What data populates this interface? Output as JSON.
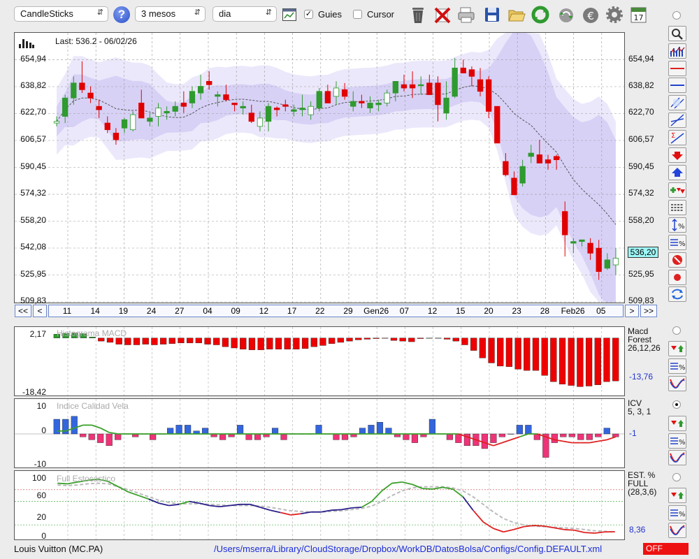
{
  "toolbar": {
    "chart_type": "CandleSticks",
    "period": "3 mesos",
    "interval": "dia",
    "guides_label": "Guies",
    "guides_checked": true,
    "cursor_label": "Cursor",
    "cursor_checked": false,
    "help_label": "?",
    "calendar_day": "17"
  },
  "main_chart": {
    "last_label": "Last: 536.2 - 06/02/26",
    "price_ticks": [
      "654,94",
      "638,82",
      "622,70",
      "606,57",
      "590,45",
      "574,32",
      "558,20",
      "542,08",
      "525,95",
      "509,83"
    ],
    "current_price": "536,20",
    "date_ticks": [
      "11",
      "14",
      "19",
      "24",
      "27",
      "04",
      "09",
      "12",
      "17",
      "22",
      "29",
      "Gen26",
      "07",
      "12",
      "15",
      "20",
      "23",
      "28",
      "Feb26",
      "05"
    ],
    "nav_first": "<<",
    "nav_prev": "<",
    "nav_next": ">",
    "nav_last": ">>"
  },
  "macd_panel": {
    "title": "Histograma MACD",
    "top_value": "2,17",
    "bottom_value": "-18,42",
    "name": "Macd",
    "subname": "Forest",
    "params": "26,12,26",
    "current_value": "-13,76"
  },
  "icv_panel": {
    "title": "Indice Calidad Vela",
    "ticks": [
      "10",
      "0",
      "-10"
    ],
    "name": "ICV",
    "params": "5, 3, 1",
    "current_value": "-1"
  },
  "stoch_panel": {
    "title": "Full Estocastico",
    "ticks": [
      "100",
      "60",
      "20",
      "0"
    ],
    "name": "EST. %",
    "subname": "FULL",
    "params": "(28,3,6)",
    "current_value": "8,36"
  },
  "status_bar": {
    "instrument": "Louis Vuitton (MC.PA)",
    "config_path": "/Users/mserra/Library/CloudStorage/Dropbox/WorkDB/DatosBolsa/Configs/Config.DEFAULT.xml",
    "toggle": "OFF"
  },
  "colors": {
    "bull": "#2f9a2f",
    "bear": "#e00000",
    "macd_bar": "#ee0000",
    "icv_pos": "#3366dd",
    "icv_neg": "#ee3377",
    "band_fill": "#ddd6f7",
    "stoch_k_up": "#3aa02a",
    "stoch_k_down": "#e02020",
    "stoch_k_mid": "#2a1f8a",
    "stoch_d": "#bbbbbb"
  },
  "chart_data": [
    {
      "type": "candlestick",
      "title": "Last: 536.2 - 06/02/26",
      "ylim": [
        509.83,
        671.07
      ],
      "x_tick_labels": [
        "11",
        "14",
        "19",
        "24",
        "27",
        "04",
        "09",
        "12",
        "17",
        "22",
        "29",
        "Gen26",
        "07",
        "12",
        "15",
        "20",
        "23",
        "28",
        "Feb26",
        "05"
      ],
      "ohlc": [
        [
          617,
          621,
          615,
          618
        ],
        [
          621,
          634,
          617,
          632
        ],
        [
          632,
          645,
          628,
          641
        ],
        [
          641,
          654,
          635,
          637
        ],
        [
          635,
          639,
          629,
          632
        ],
        [
          627,
          631,
          620,
          625
        ],
        [
          617,
          621,
          611,
          613
        ],
        [
          611,
          614,
          604,
          607
        ],
        [
          614,
          620,
          611,
          619
        ],
        [
          613,
          624,
          612,
          622
        ],
        [
          629,
          637,
          621,
          620
        ],
        [
          618,
          623,
          615,
          620
        ],
        [
          621,
          629,
          615,
          626
        ],
        [
          623,
          627,
          619,
          624
        ],
        [
          624,
          630,
          621,
          627
        ],
        [
          629,
          636,
          623,
          627
        ],
        [
          629,
          639,
          626,
          636
        ],
        [
          635,
          646,
          631,
          639
        ],
        [
          642,
          648,
          637,
          640
        ],
        [
          633,
          636,
          627,
          634
        ],
        [
          634,
          640,
          630,
          631
        ],
        [
          629,
          629,
          624,
          628
        ],
        [
          626,
          630,
          622,
          627
        ],
        [
          623,
          628,
          617,
          618
        ],
        [
          615,
          624,
          612,
          620
        ],
        [
          618,
          629,
          612,
          627
        ],
        [
          626,
          627,
          621,
          625
        ],
        [
          628,
          631,
          624,
          627
        ],
        [
          624,
          628,
          621,
          625
        ],
        [
          625,
          634,
          621,
          626
        ],
        [
          622,
          630,
          619,
          627
        ],
        [
          626,
          638,
          624,
          636
        ],
        [
          636,
          640,
          630,
          629
        ],
        [
          633,
          642,
          628,
          638
        ],
        [
          637,
          641,
          631,
          633
        ],
        [
          627,
          636,
          624,
          630
        ],
        [
          630,
          634,
          626,
          629
        ],
        [
          626,
          633,
          623,
          629
        ],
        [
          628,
          631,
          624,
          629
        ],
        [
          629,
          637,
          627,
          635
        ],
        [
          635,
          642,
          630,
          642
        ],
        [
          640,
          646,
          636,
          638
        ],
        [
          640,
          648,
          632,
          638
        ],
        [
          640,
          645,
          634,
          640
        ],
        [
          641,
          646,
          637,
          634
        ],
        [
          641,
          645,
          618,
          628
        ],
        [
          623,
          642,
          619,
          632
        ],
        [
          633,
          656,
          632,
          650
        ],
        [
          650,
          655,
          648,
          647
        ],
        [
          649,
          651,
          639,
          645
        ],
        [
          643,
          650,
          633,
          636
        ],
        [
          643,
          645,
          620,
          624
        ],
        [
          627,
          627,
          607,
          605
        ],
        [
          594,
          599,
          585,
          586
        ],
        [
          584,
          588,
          574,
          574
        ],
        [
          581,
          595,
          579,
          591
        ],
        [
          597,
          604,
          593,
          599
        ],
        [
          598,
          607,
          595,
          593
        ],
        [
          595,
          598,
          589,
          593
        ],
        [
          597,
          598,
          589,
          595
        ],
        [
          564,
          570,
          537,
          550
        ],
        [
          545,
          548,
          539,
          546
        ],
        [
          546,
          547,
          543,
          547
        ],
        [
          545,
          548,
          535,
          539
        ],
        [
          542,
          547,
          523,
          528
        ],
        [
          530,
          539,
          529,
          535
        ],
        [
          532,
          542,
          526,
          536
        ]
      ]
    },
    {
      "type": "bar",
      "title": "Histograma MACD",
      "ylim": [
        -18.42,
        2.17
      ],
      "values": [
        1.2,
        1.5,
        1.6,
        1.4,
        0.3,
        -1.0,
        -1.4,
        -2.0,
        -2.2,
        -2.2,
        -2.0,
        -2.2,
        -2.0,
        -1.8,
        -1.6,
        -1.6,
        -1.6,
        -2.0,
        -2.2,
        -2.8,
        -3.2,
        -3.6,
        -3.8,
        -3.8,
        -3.6,
        -3.6,
        -3.6,
        -3.6,
        -3.4,
        -2.8,
        -2.4,
        -1.8,
        -1.4,
        -1.0,
        -0.6,
        -0.4,
        -0.2,
        -0.1,
        -0.8,
        -1.0,
        -1.2,
        -0.2,
        0.0,
        0.0,
        -0.4,
        -1.0,
        -2.2,
        -4.0,
        -6.4,
        -8.0,
        -9.0,
        -9.2,
        -10.0,
        -10.4,
        -10.4,
        -12.0,
        -14.0,
        -14.8,
        -15.2,
        -15.6,
        -15.4,
        -15.0,
        -14.0,
        -13.76
      ]
    },
    {
      "type": "bar",
      "title": "Indice Calidad Vela",
      "ylim": [
        -10,
        10
      ],
      "values": [
        5,
        5,
        6,
        -1,
        -2,
        -3,
        -4,
        -2,
        0,
        -1,
        0,
        -2,
        0,
        2,
        3,
        3,
        1,
        2,
        -1,
        -2,
        -1,
        3,
        -2,
        -2,
        -1,
        2,
        -2,
        0,
        0,
        0,
        3,
        0,
        -2,
        -2,
        -1,
        2,
        3,
        4,
        2,
        -1,
        -2,
        -3,
        -1,
        5,
        0,
        -2,
        -3,
        -4,
        -4,
        -5,
        -3,
        -1,
        0,
        3,
        3,
        -2,
        -8,
        -3,
        -1,
        -1,
        -2,
        -2,
        -1,
        2,
        -1
      ],
      "line_y": [
        1,
        1,
        2,
        3,
        3,
        2,
        0.5,
        0,
        0,
        0,
        0,
        0,
        0,
        0,
        0,
        0,
        0,
        0,
        0,
        0,
        0,
        0,
        0,
        0,
        0,
        0,
        0,
        0,
        0,
        0,
        0,
        0,
        0,
        0,
        0,
        0,
        0,
        0,
        0,
        0,
        0,
        0,
        0,
        0,
        0,
        0,
        0,
        -1,
        -2,
        -3,
        -4,
        -3,
        -2,
        -1,
        0,
        0,
        -1,
        -2,
        -2.5,
        -3,
        -3,
        -3,
        -2.5,
        -2,
        -1
      ]
    },
    {
      "type": "line",
      "title": "Full Estocastico",
      "ylim": [
        0,
        100
      ],
      "series": [
        {
          "values": [
            91,
            90,
            93,
            96,
            98,
            94,
            85,
            76,
            70,
            64,
            57,
            53,
            55,
            60,
            57,
            53,
            51,
            53,
            55,
            55,
            50,
            45,
            41,
            37,
            39,
            42,
            42,
            45,
            46,
            49,
            50,
            60,
            78,
            91,
            93,
            89,
            82,
            81,
            84,
            81,
            68,
            45,
            25,
            14,
            8,
            12,
            17,
            19,
            18,
            15,
            12,
            11,
            7,
            6,
            8,
            8.36
          ]
        },
        {
          "values": [
            88,
            87,
            88,
            90,
            91,
            90,
            85,
            80,
            74,
            68,
            62,
            58,
            56,
            56,
            56,
            55,
            54,
            53,
            53,
            53,
            52,
            50,
            47,
            44,
            43,
            42,
            42,
            43,
            44,
            46,
            48,
            52,
            60,
            70,
            78,
            83,
            85,
            85,
            85,
            83,
            78,
            68,
            55,
            42,
            31,
            24,
            20,
            18,
            17,
            16,
            15,
            14,
            12,
            10,
            9,
            8
          ]
        }
      ]
    }
  ]
}
